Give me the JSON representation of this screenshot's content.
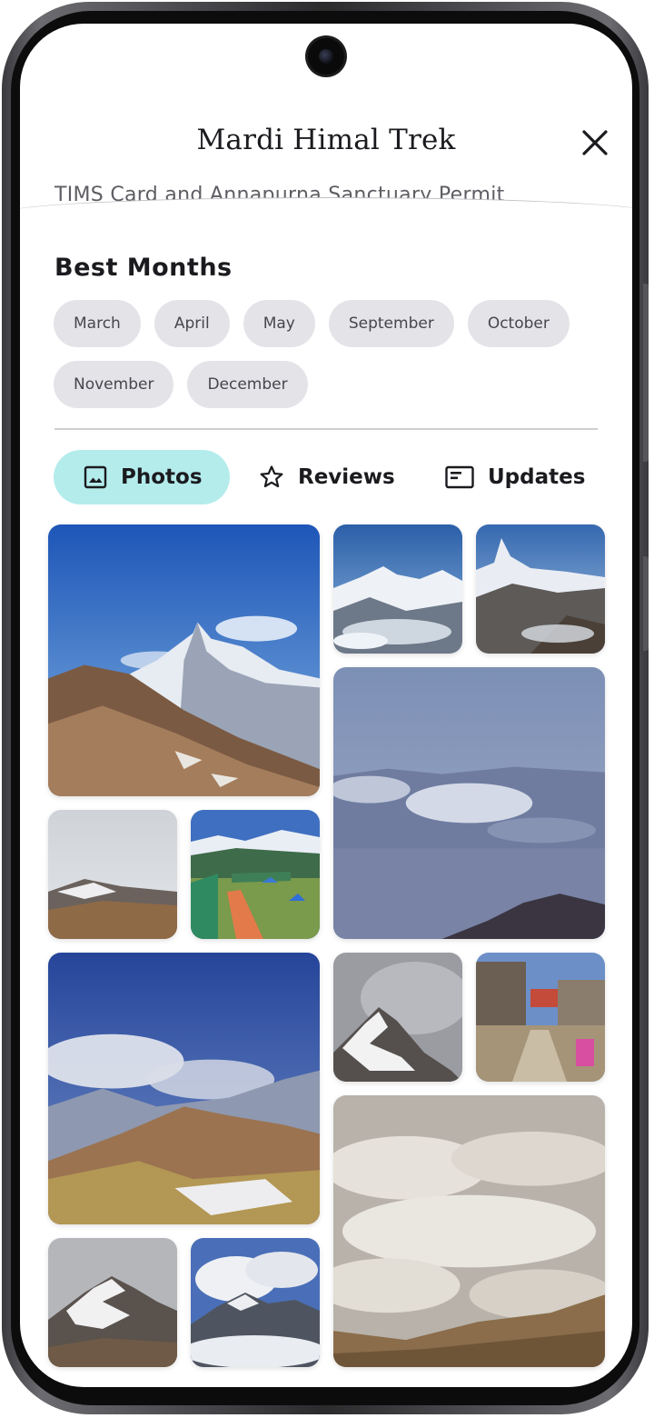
{
  "header": {
    "title": "Mardi Himal Trek",
    "close_icon": "close-icon",
    "permit_text": "TIMS Card and Annapurna Sanctuary Permit"
  },
  "best_months": {
    "heading": "Best Months",
    "months": [
      "March",
      "April",
      "May",
      "September",
      "October",
      "November",
      "December"
    ]
  },
  "tabs": [
    {
      "label": "Photos",
      "icon": "image-icon",
      "active": true
    },
    {
      "label": "Reviews",
      "icon": "star-icon",
      "active": false
    },
    {
      "label": "Updates",
      "icon": "newspaper-icon",
      "active": false
    }
  ],
  "photos": [
    {
      "scene": "machapuchare-peak-brown-ridge"
    },
    {
      "scene": "snowy-range-clouds"
    },
    {
      "scene": "fishtail-peak-close"
    },
    {
      "scene": "sea-of-clouds-blue"
    },
    {
      "scene": "snow-patch-ridge-hazy"
    },
    {
      "scene": "camp-tents-green-roofs"
    },
    {
      "scene": "ridge-with-clouds-grass"
    },
    {
      "scene": "misty-snowy-peak"
    },
    {
      "scene": "village-stone-path"
    },
    {
      "scene": "cloud-carpet-sunset"
    },
    {
      "scene": "snow-peak-grey-sky"
    },
    {
      "scene": "peak-above-clouds"
    }
  ],
  "colors": {
    "active_tab": "#b4ecec",
    "chip_bg": "#e4e3e8",
    "text_primary": "#1b1b1f"
  }
}
